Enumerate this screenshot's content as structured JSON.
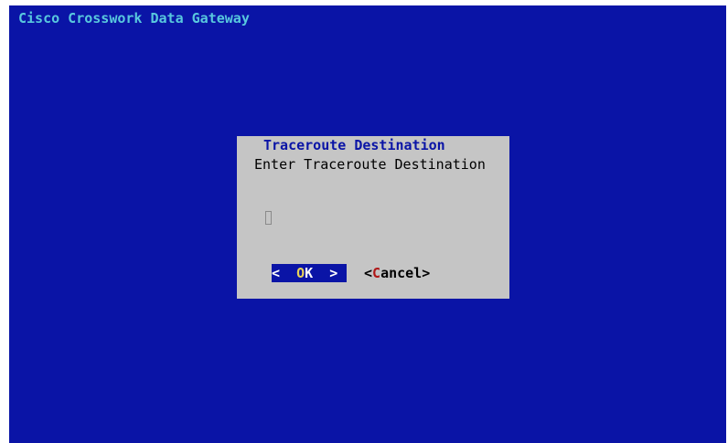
{
  "app": {
    "backtitle": "Cisco Crosswork Data Gateway"
  },
  "dialog": {
    "title": "Traceroute Destination",
    "prompt": "Enter Traceroute Destination",
    "input": {
      "value": "",
      "placeholder": ""
    }
  },
  "buttons": {
    "ok": {
      "left": "<  ",
      "hotkey": "O",
      "rest": "K",
      "right": "  >"
    },
    "cancel": {
      "left": "<",
      "hotkey": "C",
      "rest": "ancel",
      "right": ">"
    }
  },
  "colors": {
    "screen_background": "#0a14a6",
    "backtitle": "#58c8de",
    "dialog_background": "#c5c5c5",
    "dialog_title": "#0a14a6",
    "selected_button_background": "#0a14a6",
    "ok_hotkey": "#e8d25a",
    "cancel_hotkey": "#b01818"
  }
}
